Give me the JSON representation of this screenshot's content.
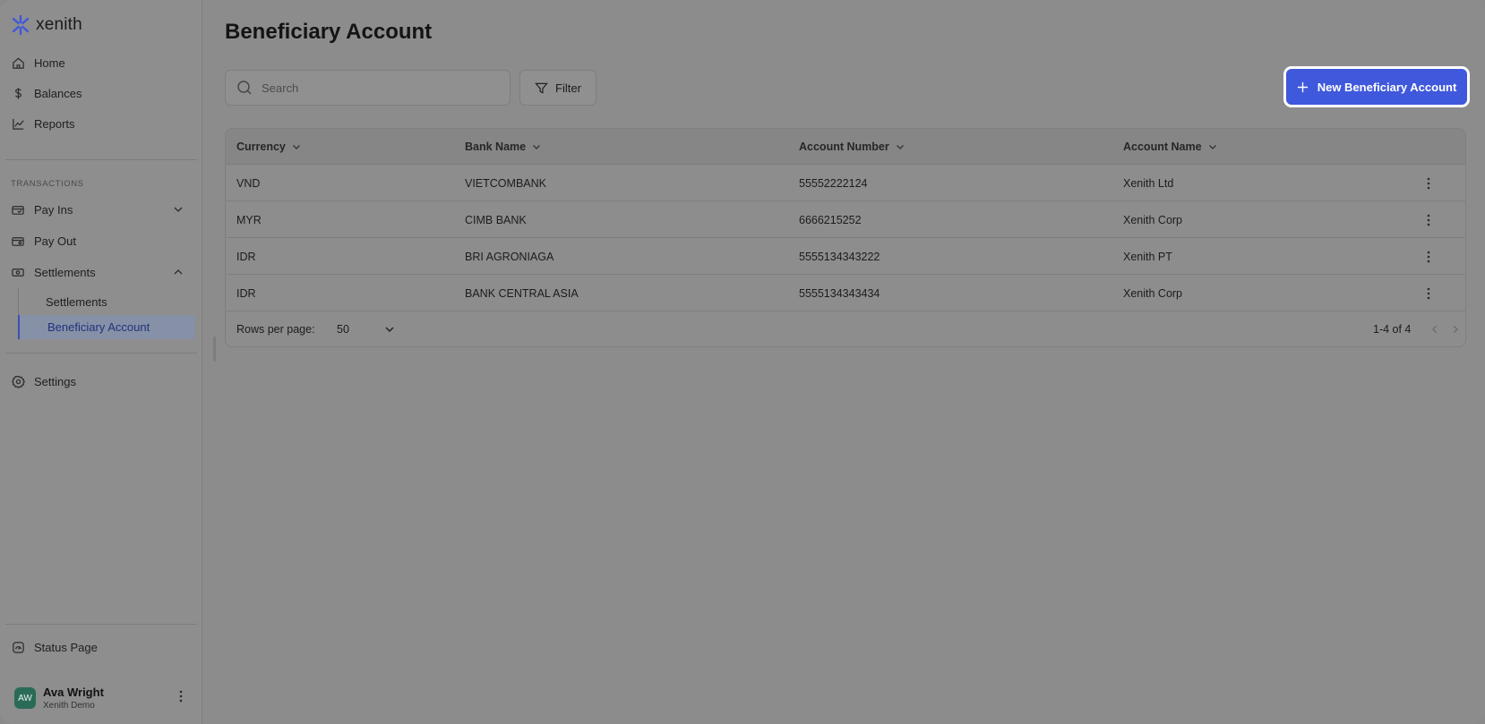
{
  "app": {
    "logo_text": "xenith",
    "brand_color": "#3f58dc"
  },
  "sidebar": {
    "nav": [
      {
        "label": "Home",
        "icon": "home-icon"
      },
      {
        "label": "Balances",
        "icon": "dollar-icon"
      },
      {
        "label": "Reports",
        "icon": "chart-line-icon"
      }
    ],
    "transactions_label": "TRANSACTIONS",
    "transactions": [
      {
        "label": "Pay Ins",
        "icon": "wallet-in-icon",
        "expanded": false
      },
      {
        "label": "Pay Out",
        "icon": "wallet-out-icon"
      },
      {
        "label": "Settlements",
        "icon": "cash-icon",
        "expanded": true
      }
    ],
    "settlements_sub": [
      {
        "label": "Settlements",
        "active": false
      },
      {
        "label": "Beneficiary Account",
        "active": true
      }
    ],
    "settings": {
      "label": "Settings",
      "icon": "gear-icon"
    },
    "status": {
      "label": "Status Page",
      "icon": "status-icon"
    },
    "user": {
      "initials": "AW",
      "name": "Ava Wright",
      "org": "Xenith Demo"
    }
  },
  "main": {
    "title": "Beneficiary Account",
    "search_placeholder": "Search",
    "filter_label": "Filter",
    "new_button_label": "New Beneficiary Account",
    "table": {
      "columns": [
        "Currency",
        "Bank Name",
        "Account Number",
        "Account Name"
      ],
      "rows": [
        [
          "VND",
          "VIETCOMBANK",
          "55552222124",
          "Xenith Ltd"
        ],
        [
          "MYR",
          "CIMB BANK",
          "6666215252",
          "Xenith Corp"
        ],
        [
          "IDR",
          "BRI AGRONIAGA",
          "5555134343222",
          "Xenith PT"
        ],
        [
          "IDR",
          "BANK CENTRAL ASIA",
          "5555134343434",
          "Xenith Corp"
        ]
      ]
    },
    "footer": {
      "rows_per_page_label": "Rows per page:",
      "rows_per_page_value": "50",
      "range_text": "1-4 of 4"
    }
  }
}
